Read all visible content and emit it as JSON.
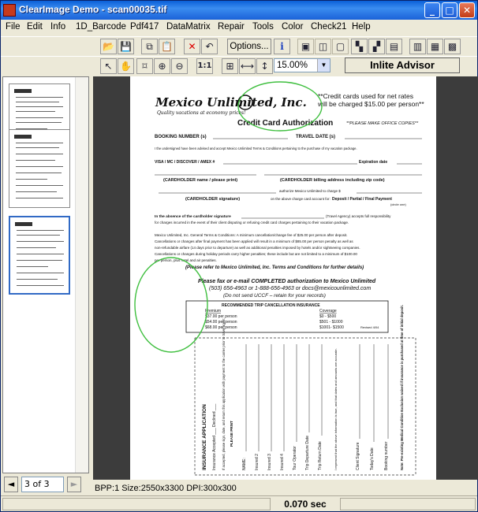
{
  "window": {
    "title": "ClearImage Demo - scan00035.tif",
    "minimize_glyph": "_",
    "maximize_glyph": "□",
    "close_glyph": "✕"
  },
  "menu": [
    "File",
    "Edit",
    "Info",
    "1D_Barcode",
    "Pdf417",
    "DataMatrix",
    "Repair",
    "Tools",
    "Color",
    "Check21",
    "Help"
  ],
  "toolbar": {
    "options_label": "Options...",
    "info_glyph": "i",
    "zoom_value": "15.00%",
    "fit_label": "1:1",
    "advisor_label": "Inlite Advisor"
  },
  "navigation": {
    "page_value": "3 of 3",
    "prev_glyph": "◄",
    "next_glyph": "►"
  },
  "info_bar": "BPP:1 Size:2550x3300 DPI:300x300",
  "status": {
    "time": "0.070 sec"
  },
  "document": {
    "logo": "Mexico Unlimited, Inc.",
    "tagline": "Quality vacations at economy prices!",
    "note_line1": "**Credit cards used for net rates",
    "note_line2": "will be charged $15.00 per person**",
    "heading": "Credit Card Authorization",
    "heading_note": "**PLEASE MAKE OFFICE COPIES**",
    "booking_number": "BOOKING NUMBER (s)",
    "travel_date": "TRAVEL DATE (s)",
    "advised": "I the undersigned have been advised and accept Mexico Unlimited Terms & Conditions pertaining to the purchase of my vacation package.",
    "card_line": "VISA / MC / DISCOVER / AMEX #",
    "expiration": "Expiration date",
    "cardholder_name": "(CARDHOLDER name / please print)",
    "cardholder_address": "(CARDHOLDER billing address including zip code)",
    "authorize": "authorize Mexico Unlimited to charge $",
    "cardholder_signature": "(CARDHOLDER signature)",
    "on_card": "on the above charge card account for:",
    "deposit": "Deposit / Partial / Final Payment",
    "circle_one": "(circle one)",
    "absence1": "In the absence of the cardholder signature",
    "absence_agency": "(Travel Agency) accepts full responsibility",
    "absence2": "for charges incurred in the event of their client disputing or refusing credit card charges pertaining to their vacation package.",
    "terms_lines": [
      "Mexico Unlimited, Inc. General Terms & Conditions:  A minimum cancellation/change fee of $25.00 per person after deposit.",
      "Cancellations or changes after final payment has been applied will result in a minimum of $85.00 per person penalty as well as",
      "non-refundable airfare (14 days prior to departure) as well as additional penalties imposed by hotels and/or sightseeing companies.",
      "Cancellations or changes during holiday periods carry higher penalties; these include but are not limited to a minimum of $100.00",
      "per person, plus hotel and air penalties."
    ],
    "refer": "(Please refer to Mexico Unlimited, Inc. Terms and Conditions for further details)",
    "fax1": "Please fax or e-mail COMPLETED authorization to Mexico Unlimited",
    "fax2": "(503) 656-4963 or 1-888-656-4963 or docs@mexicounlimited.com",
    "fax3": "(Do not send UCCF – retain for your records)",
    "ins_title": "RECOMMENDED TRIP CANCELLATION INSURANCE",
    "premium": "Premium",
    "coverage": "Coverage",
    "ins_rows": [
      [
        "$37.00 per person",
        "$0 - $500"
      ],
      [
        "$54.00 per person",
        "$501 - $1000"
      ],
      [
        "$68.00 per person",
        "$1001- $1500"
      ]
    ],
    "revised": "Revised 4/04",
    "app_title": "INSURANCE APPLICATION",
    "app_cols": [
      "Insurance Accepted ___ Declined ___",
      "If accepted, please sign, date, and return this application with payment to the carrier prior to travel agent.",
      "PLEASE PRINT",
      "NAME:",
      "Insured 2",
      "Insured 3",
      "Insured 4",
      "Tour Operator",
      "Trip Departure Date",
      "Trip Return Date",
      "I represent that the above information is true, and that dates and amounts are accurate.",
      "Client Signature",
      "Today's Date",
      "Booking number",
      "Note: Pre-existing Medical Condition Exclusion waived if insurance is purchased at time of initial deposit."
    ]
  }
}
